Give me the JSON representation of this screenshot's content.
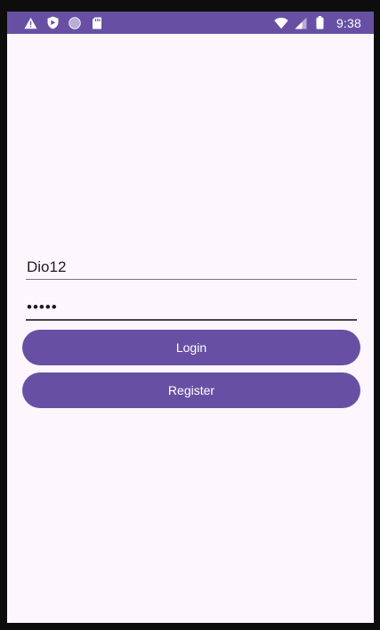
{
  "status_bar": {
    "time": "9:38",
    "background": "#6750a4",
    "left_icons": [
      "warning-icon",
      "shield-icon",
      "circle-icon",
      "sd-card-icon"
    ],
    "right_icons": [
      "wifi-icon",
      "cell-signal-icon",
      "battery-icon"
    ]
  },
  "login_form": {
    "username": {
      "value": "Dio12"
    },
    "password": {
      "value": "•••••"
    },
    "login_label": "Login",
    "register_label": "Register"
  },
  "colors": {
    "accent": "#6750a4",
    "background": "#fdf7fd",
    "text": "#1c1b1f"
  }
}
